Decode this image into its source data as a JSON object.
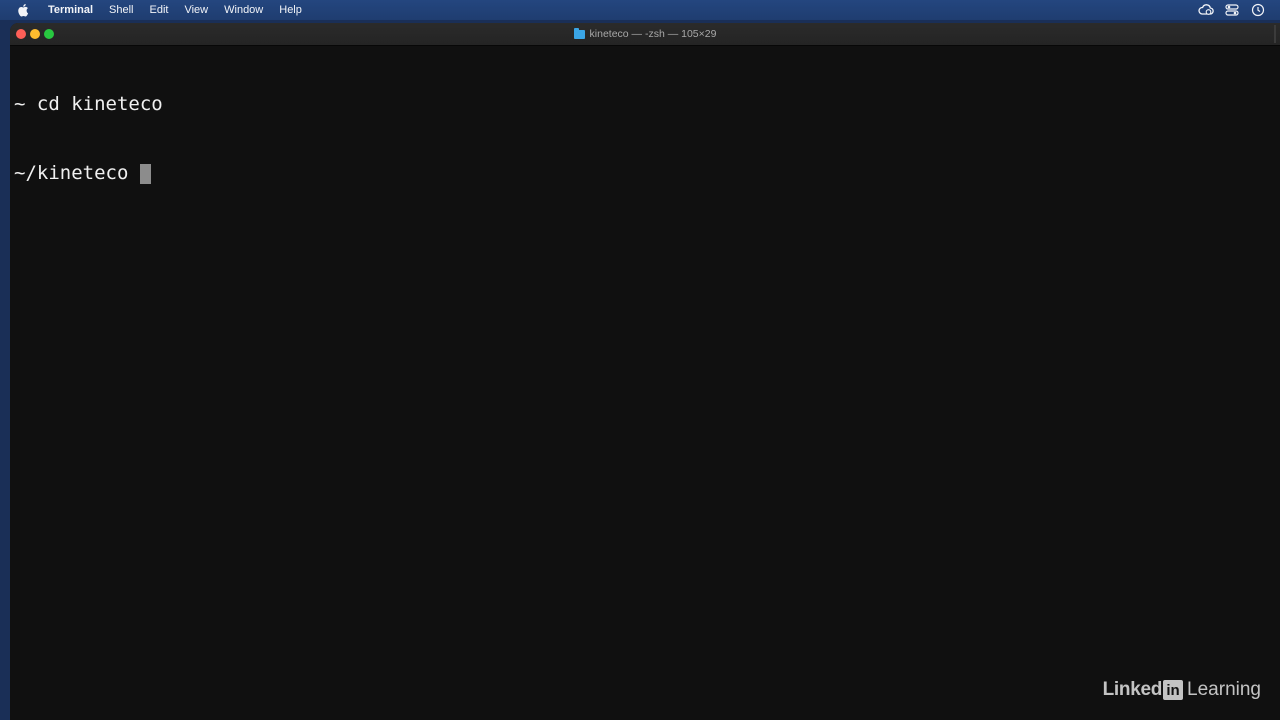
{
  "menubar": {
    "items": [
      {
        "label": "Terminal",
        "bold": true
      },
      {
        "label": "Shell"
      },
      {
        "label": "Edit"
      },
      {
        "label": "View"
      },
      {
        "label": "Window"
      },
      {
        "label": "Help"
      }
    ],
    "status_icons": [
      "cloud-sync-icon",
      "control-center-icon",
      "time-machine-icon"
    ]
  },
  "window": {
    "title": "kineteco — -zsh — 105×29",
    "title_icon": "folder-icon",
    "traffic_lights": {
      "close": "#fe5f57",
      "minimize": "#febc2e",
      "zoom": "#28c840"
    }
  },
  "terminal": {
    "lines": [
      "~ cd kineteco",
      "~/kineteco "
    ],
    "cursor_color": "#8c8c8c",
    "background": "#101010"
  },
  "watermark": {
    "linked": "Linked",
    "in": "in",
    "learning": "Learning"
  }
}
